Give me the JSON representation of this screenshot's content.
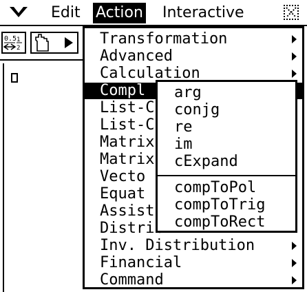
{
  "menubar": {
    "edit": "Edit",
    "action": "Action",
    "interactive": "Interactive",
    "icon": "chevron-down-icon",
    "close_icon": "close-icon"
  },
  "toolbar": {
    "frac_icon": "fraction-decimal-icon",
    "hand_icon": "hand-pointer-icon",
    "play_icon": "play-triangle-icon"
  },
  "dropdown": {
    "items": [
      {
        "label": "Transformation",
        "submenu": true
      },
      {
        "label": "Advanced",
        "submenu": true
      },
      {
        "label": "Calculation",
        "submenu": true
      },
      {
        "label": "Compl",
        "submenu": true,
        "selected": true
      },
      {
        "label": "List-C",
        "submenu": true
      },
      {
        "label": "List-C",
        "submenu": true
      },
      {
        "label": "Matrix",
        "submenu": true
      },
      {
        "label": "Matrix",
        "submenu": true
      },
      {
        "label": "Vecto",
        "submenu": true
      },
      {
        "label": "Equat",
        "submenu": true
      },
      {
        "label": "Assist",
        "submenu": true
      },
      {
        "label": "Distrib",
        "submenu": true
      },
      {
        "label": "Inv. Distribution",
        "submenu": true
      },
      {
        "label": "Financial",
        "submenu": true
      },
      {
        "label": "Command",
        "submenu": true
      }
    ]
  },
  "submenu": {
    "items": [
      "arg",
      "conjg",
      "re",
      "im",
      "cExpand",
      "compToPol",
      "compToTrig",
      "compToRect"
    ]
  },
  "colors": {
    "foreground": "#000000",
    "background": "#ffffff"
  }
}
